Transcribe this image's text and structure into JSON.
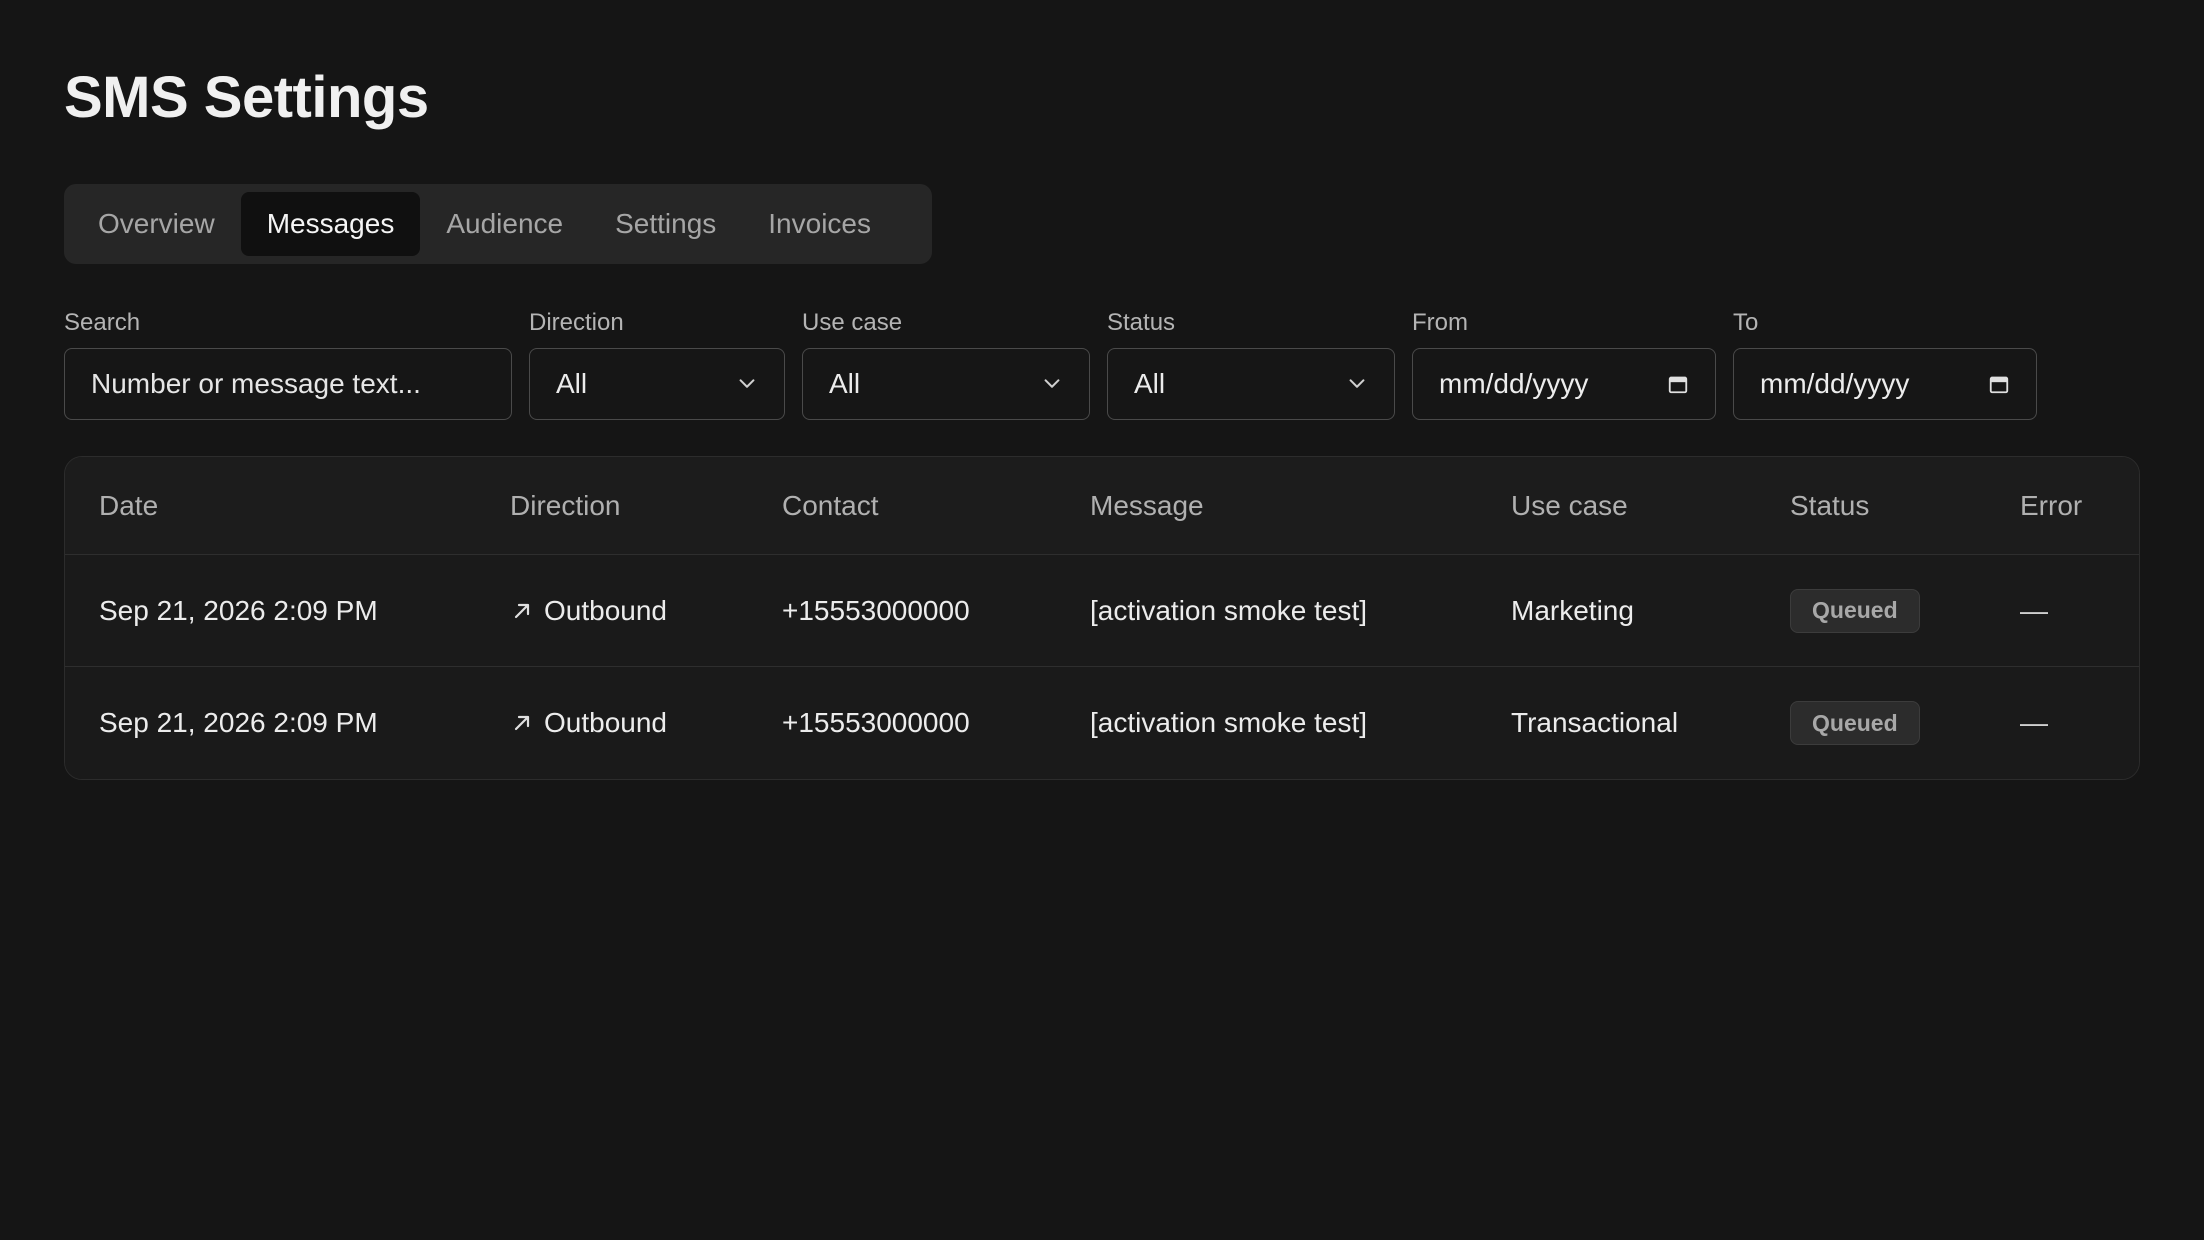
{
  "page": {
    "title": "SMS Settings"
  },
  "tabs": [
    {
      "label": "Overview",
      "active": false
    },
    {
      "label": "Messages",
      "active": true
    },
    {
      "label": "Audience",
      "active": false
    },
    {
      "label": "Settings",
      "active": false
    },
    {
      "label": "Invoices",
      "active": false
    }
  ],
  "filters": {
    "search": {
      "label": "Search",
      "placeholder": "Number or message text..."
    },
    "direction": {
      "label": "Direction",
      "value": "All"
    },
    "use_case": {
      "label": "Use case",
      "value": "All"
    },
    "status": {
      "label": "Status",
      "value": "All"
    },
    "from": {
      "label": "From",
      "value": "mm/dd/yyyy"
    },
    "to": {
      "label": "To",
      "value": "mm/dd/yyyy"
    }
  },
  "table": {
    "columns": [
      "Date",
      "Direction",
      "Contact",
      "Message",
      "Use case",
      "Status",
      "Error"
    ],
    "rows": [
      {
        "date": "Sep 21, 2026 2:09 PM",
        "direction": "Outbound",
        "contact": "+15553000000",
        "message": "[activation smoke test]",
        "use_case": "Marketing",
        "status": "Queued",
        "error": "—"
      },
      {
        "date": "Sep 21, 2026 2:09 PM",
        "direction": "Outbound",
        "contact": "+15553000000",
        "message": "[activation smoke test]",
        "use_case": "Transactional",
        "status": "Queued",
        "error": "—"
      }
    ]
  },
  "icons": {
    "select_chevron": "chevron-down-icon",
    "date_picker": "calendar-icon",
    "direction": "arrow-up-right-icon"
  },
  "colors": {
    "background": "#151515",
    "tab_bar": "#262626",
    "tab_active": "#101010",
    "badge_bg": "#2c2c2c",
    "border": "#4a4a4a"
  }
}
